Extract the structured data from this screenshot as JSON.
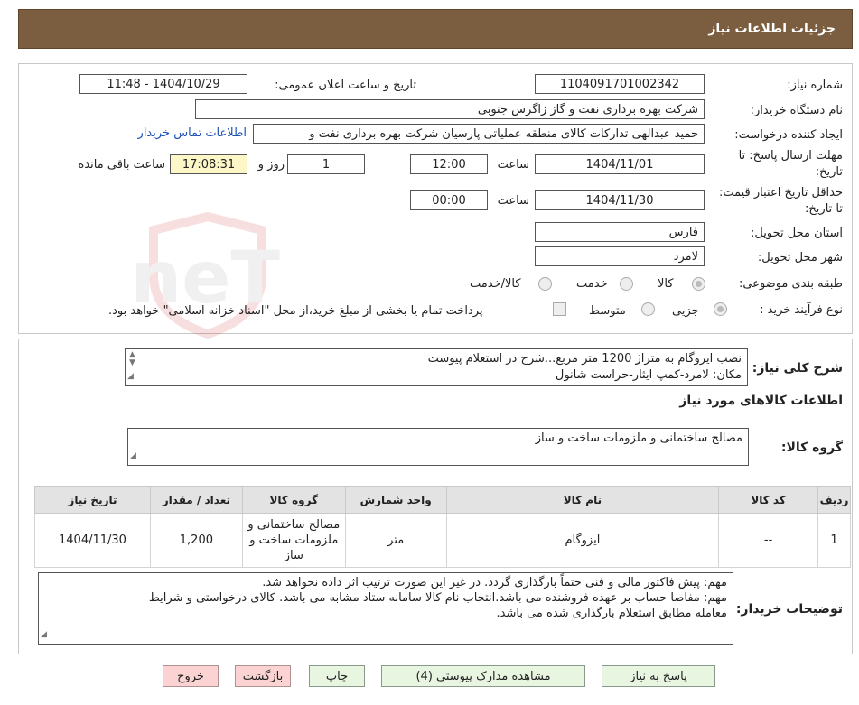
{
  "header": {
    "title": "جزئیات اطلاعات نیاز"
  },
  "form": {
    "need_number_label": "شماره نیاز:",
    "need_number": "1104091701002342",
    "announce_label": "تاریخ و ساعت اعلان عمومی:",
    "announce_value": "1404/10/29 - 11:48",
    "buyer_org_label": "نام دستگاه خریدار:",
    "buyer_org": "شرکت بهره برداری نفت و گاز زاگرس جنوبی",
    "creator_label": "ایجاد کننده درخواست:",
    "creator": "حمید عبدالهی تدارکات کالای منطقه عملیاتی پارسیان شرکت بهره برداری نفت و",
    "contact_link": "اطلاعات تماس خریدار",
    "reply_deadline_label": "مهلت ارسال پاسخ: تا تاریخ:",
    "reply_date": "1404/11/01",
    "time_label": "ساعت",
    "reply_time": "12:00",
    "days": "1",
    "days_label": "روز و",
    "remaining_time": "17:08:31",
    "remaining_label": "ساعت باقی مانده",
    "validity_label": "حداقل تاریخ اعتبار قیمت: تا تاریخ:",
    "validity_date": "1404/11/30",
    "validity_time_label": "ساعت",
    "validity_time": "00:00",
    "province_label": "استان محل تحویل:",
    "province": "فارس",
    "city_label": "شهر محل تحویل:",
    "city": "لامرد",
    "category_label": "طبقه بندی موضوعی:",
    "category_options": [
      "کالا",
      "خدمت",
      "کالا/خدمت"
    ],
    "process_label": "نوع فرآیند خرید :",
    "process_options": [
      "جزیی",
      "متوسط"
    ],
    "payment_note": "پرداخت تمام یا بخشی از مبلغ خرید،از محل \"اسناد خزانه اسلامی\" خواهد بود."
  },
  "description": {
    "label": "شرح کلی نیاز:",
    "line1": "نصب ایزوگام به متراژ 1200 متر مربع...شرح در استعلام پیوست",
    "line2": "مکان: لامرد-کمپ ایثار-حراست شانول"
  },
  "goods": {
    "section_title": "اطلاعات کالاهای مورد نیاز",
    "group_label": "گروه کالا:",
    "group_value": "مصالح ساختمانی و ملزومات ساخت و ساز",
    "columns": [
      "ردیف",
      "کد کالا",
      "نام کالا",
      "واحد شمارش",
      "گروه کالا",
      "تعداد / مقدار",
      "تاریخ نیاز"
    ],
    "rows": [
      {
        "row": "1",
        "code": "--",
        "name": "ایزوگام",
        "unit": "متر",
        "group": "مصالح ساختمانی و ملزومات ساخت و ساز",
        "qty": "1,200",
        "date": "1404/11/30"
      }
    ]
  },
  "buyer_notes": {
    "label": "توضیحات خریدار:",
    "line1": "مهم: پیش فاکتور مالی و فنی حتماً بارگذاری گردد. در غیر این صورت ترتیب اثر داده نخواهد شد.",
    "line2": "مهم: مفاصا حساب بر عهده فروشنده می باشد.انتخاب نام کالا سامانه ستاد مشابه می باشد. کالای درخواستی و شرایط",
    "line3": "معامله مطابق استعلام بارگذاری شده می باشد."
  },
  "buttons": {
    "reply": "پاسخ به نیاز",
    "attachments": "مشاهده مدارک پیوستی (4)",
    "print": "چاپ",
    "back": "بازگشت",
    "exit": "خروج"
  },
  "watermark_text": "AriaTender.neT",
  "colors": {
    "header_bg": "#7b5d3f",
    "button_green": "#e8f5e0",
    "button_red": "#fbd3d3",
    "link": "#1a4fb5"
  }
}
